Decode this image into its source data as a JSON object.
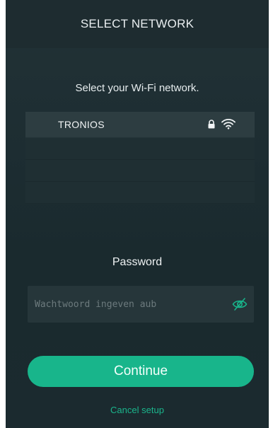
{
  "header": {
    "title": "SELECT NETWORK"
  },
  "subtitle": "Select your Wi-Fi network.",
  "networks": [
    {
      "name": "TRONIOS",
      "secured": true,
      "signal_icon": "wifi-icon",
      "lock_icon": "lock-icon"
    }
  ],
  "password": {
    "label": "Password",
    "placeholder": "Wachtwoord ingeven aub",
    "value": "",
    "visibility_icon": "eye-off-icon"
  },
  "actions": {
    "continue_label": "Continue",
    "cancel_label": "Cancel setup"
  },
  "colors": {
    "accent": "#18b58b",
    "background": "#1d2d32",
    "header_bg": "#1e2c30"
  }
}
